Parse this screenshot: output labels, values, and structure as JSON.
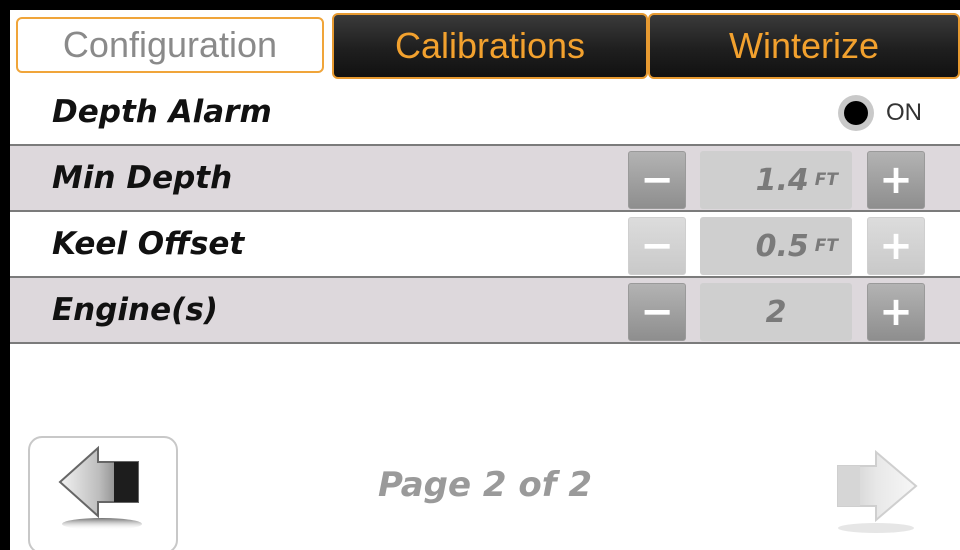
{
  "tabs": [
    {
      "label": "Configuration",
      "active": true
    },
    {
      "label": "Calibrations",
      "active": false
    },
    {
      "label": "Winterize",
      "active": false
    }
  ],
  "rows": {
    "depth_alarm": {
      "label": "Depth Alarm",
      "toggle_state": "ON"
    },
    "min_depth": {
      "label": "Min Depth",
      "value": "1.4",
      "unit": "FT",
      "minus_label": "−",
      "plus_label": "+"
    },
    "keel_offset": {
      "label": "Keel Offset",
      "value": "0.5",
      "unit": "FT",
      "minus_label": "−",
      "plus_label": "+"
    },
    "engines": {
      "label": "Engine(s)",
      "value": "2",
      "minus_label": "−",
      "plus_label": "+"
    }
  },
  "footer": {
    "page_indicator": "Page 2 of 2",
    "prev_icon": "left-arrow-icon",
    "next_icon": "right-arrow-icon"
  },
  "colors": {
    "accent": "#f2a12e",
    "row_shade": "#ddd8dc"
  }
}
